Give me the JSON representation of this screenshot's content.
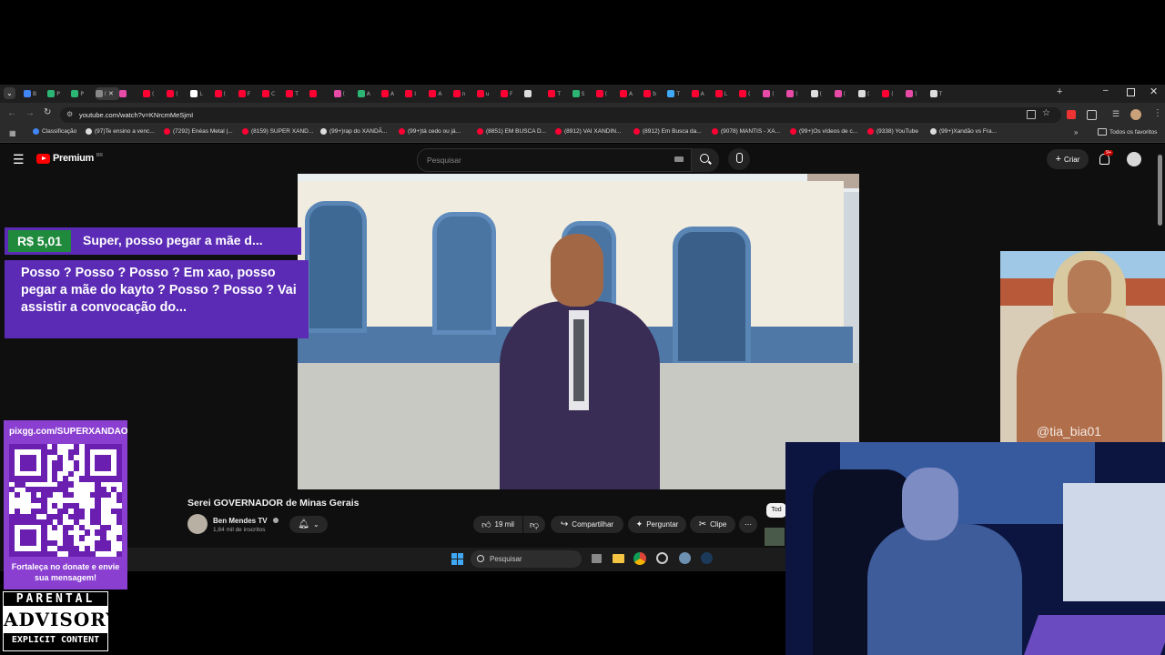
{
  "browser": {
    "url": "youtube.com/watch?v=KNrcmMeSjmI",
    "tabs": [
      "B",
      "P",
      "P",
      "(",
      "",
      "(",
      "(",
      "L",
      "(",
      "F",
      "C",
      "T",
      "",
      "(",
      "A",
      "A",
      "I",
      "A",
      "n",
      "u",
      "F",
      "",
      "T",
      "S",
      "(",
      "A",
      "b",
      "T",
      "A",
      "L",
      "(",
      "(",
      "(",
      "(",
      "(",
      "(",
      "(",
      "(",
      "T"
    ],
    "new_tab": "+",
    "bookmarks": [
      "Classificação",
      "(97)Te ensino a venc...",
      "(7292) Enéas Metal |...",
      "(8159) SUPER XAND...",
      "(99+)rap do XANDÃ...",
      "(99+)tá cedo ou já...",
      "(8851) EM BUSCA D...",
      "(8912) VAI XANDIN...",
      "(8912) Em Busca da...",
      "(9078) MANTIS - XA...",
      "(99+)Os vídeos de c...",
      "(9338) YouTube",
      "(99+)Xandão vs Fra..."
    ],
    "all_bookmarks": "Todos os favoritos"
  },
  "youtube": {
    "logo": "Premium",
    "logo_badge": "BR",
    "search_placeholder": "Pesquisar",
    "create": "Criar",
    "notif_count": "9+",
    "video_title": "Serei GOVERNADOR de Minas Gerais",
    "channel": "Ben Mendes TV",
    "subscribers": "1,84 mil de inscritos",
    "likes": "19 mil",
    "share": "Compartilhar",
    "ask": "Perguntar",
    "clip": "Clipe",
    "more": "⋯",
    "chip": "Tod"
  },
  "taskbar": {
    "search": "Pesquisar"
  },
  "donation": {
    "amount": "R$ 5,01",
    "name": "Super, posso pegar a mãe d...",
    "message": "Posso ? Posso ? Posso ? Em xao, posso pegar a mãe do kayto ? Posso ? Posso ? Vai assistir a convocação do..."
  },
  "qr": {
    "url": "pixgg.com/SUPERXANDAO",
    "caption": "Fortaleça no donate e envie sua mensagem!"
  },
  "advisory": {
    "top": "PARENTAL",
    "mid": "ADVISORY",
    "bottom": "EXPLICIT CONTENT"
  },
  "photo_watermark": "@tia_bia01",
  "colors": {
    "accent_purple": "#5b2bb5",
    "donation_green": "#1f8a3c",
    "yt_red": "#ff0000"
  }
}
